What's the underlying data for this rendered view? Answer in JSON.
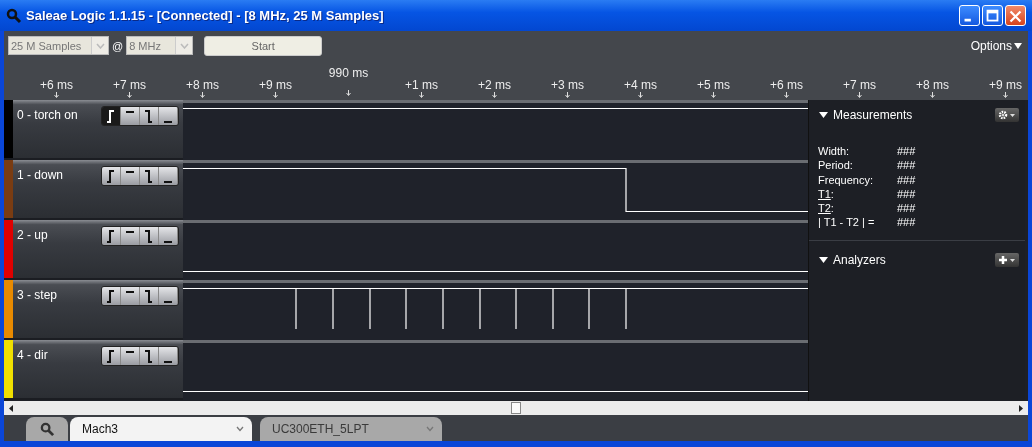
{
  "window": {
    "title": "Saleae Logic 1.1.15 - [Connected] - [8 MHz, 25 M Samples]"
  },
  "toolbar": {
    "samples": "25 M Samples",
    "at": "@",
    "rate": "8 MHz",
    "start": "Start",
    "options": "Options"
  },
  "ruler": [
    {
      "label": "+6 ms",
      "kind": "minor"
    },
    {
      "label": "+7 ms",
      "kind": "minor"
    },
    {
      "label": "+8 ms",
      "kind": "minor"
    },
    {
      "label": "+9 ms",
      "kind": "minor"
    },
    {
      "label": "990 ms",
      "kind": "major"
    },
    {
      "label": "+1 ms",
      "kind": "minor"
    },
    {
      "label": "+2 ms",
      "kind": "minor"
    },
    {
      "label": "+3 ms",
      "kind": "minor"
    },
    {
      "label": "+4 ms",
      "kind": "minor"
    },
    {
      "label": "+5 ms",
      "kind": "minor"
    },
    {
      "label": "+6 ms",
      "kind": "minor"
    },
    {
      "label": "+7 ms",
      "kind": "minor"
    },
    {
      "label": "+8 ms",
      "kind": "minor"
    },
    {
      "label": "+9 ms",
      "kind": "minor"
    }
  ],
  "channels": [
    {
      "name": "0 - torch on",
      "color": "#000000",
      "kind": "high",
      "triggers": [
        {
          "kind": "rising",
          "selected": true
        },
        {
          "kind": "high",
          "selected": false
        },
        {
          "kind": "falling",
          "selected": false
        },
        {
          "kind": "low",
          "selected": false
        }
      ]
    },
    {
      "name": "1 - down",
      "color": "#7a3c12",
      "kind": "falling",
      "triggers": [
        {
          "kind": "rising",
          "selected": false
        },
        {
          "kind": "high",
          "selected": false
        },
        {
          "kind": "falling",
          "selected": false
        },
        {
          "kind": "low",
          "selected": false
        }
      ]
    },
    {
      "name": "2 - up",
      "color": "#e00000",
      "kind": "low",
      "triggers": [
        {
          "kind": "rising",
          "selected": false
        },
        {
          "kind": "high",
          "selected": false
        },
        {
          "kind": "falling",
          "selected": false
        },
        {
          "kind": "low",
          "selected": false
        }
      ]
    },
    {
      "name": "3 - step",
      "color": "#e88a00",
      "kind": "pulses",
      "triggers": [
        {
          "kind": "rising",
          "selected": false
        },
        {
          "kind": "high",
          "selected": false
        },
        {
          "kind": "falling",
          "selected": false
        },
        {
          "kind": "low",
          "selected": false
        }
      ]
    },
    {
      "name": "4 - dir",
      "color": "#f0e000",
      "kind": "low",
      "triggers": [
        {
          "kind": "rising",
          "selected": false
        },
        {
          "kind": "high",
          "selected": false
        },
        {
          "kind": "falling",
          "selected": false
        },
        {
          "kind": "low",
          "selected": false
        }
      ]
    }
  ],
  "measurements": {
    "title": "Measurements",
    "rows": [
      {
        "label": "Width:",
        "value": "###"
      },
      {
        "label": "Period:",
        "value": "###"
      },
      {
        "label": "Frequency:",
        "value": "###"
      },
      {
        "label": "T1",
        "link": true,
        "suffix": ":",
        "value": "###"
      },
      {
        "label": "T2",
        "link": true,
        "suffix": ":",
        "value": "###"
      },
      {
        "label": "| T1 - T2 | =",
        "value": "###"
      }
    ]
  },
  "analyzers": {
    "title": "Analyzers"
  },
  "tabs": [
    {
      "kind": "search",
      "selected": false
    },
    {
      "kind": "session",
      "label": "Mach3",
      "selected": true
    },
    {
      "kind": "session",
      "label": "UC300ETH_5LPT",
      "selected": false
    }
  ]
}
